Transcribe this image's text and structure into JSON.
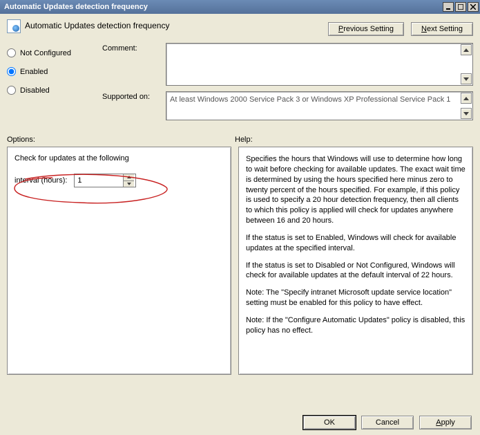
{
  "window": {
    "title": "Automatic Updates detection frequency"
  },
  "header": {
    "title": "Automatic Updates detection frequency",
    "prev_label": "Previous Setting",
    "next_label": "Next Setting"
  },
  "state": {
    "not_configured_label": "Not Configured",
    "enabled_label": "Enabled",
    "disabled_label": "Disabled",
    "selected": "enabled"
  },
  "meta": {
    "comment_label": "Comment:",
    "comment_value": "",
    "supported_label": "Supported on:",
    "supported_value": "At least Windows 2000 Service Pack 3 or Windows XP Professional Service Pack 1"
  },
  "sections": {
    "options_label": "Options:",
    "help_label": "Help:"
  },
  "options": {
    "heading": "Check for updates at the following",
    "interval_label": "interval (hours):",
    "interval_value": "1"
  },
  "help": {
    "p1": "Specifies the hours that Windows will use to determine how long to wait before checking for available updates. The exact wait time is determined by using the hours specified here minus zero to twenty percent of the hours specified. For example, if this policy is used to specify a 20 hour detection frequency, then all clients to which this policy is applied will check for updates anywhere between 16 and 20 hours.",
    "p2": "If the status is set to Enabled, Windows will check for available updates at the specified interval.",
    "p3": "If the status is set to Disabled or Not Configured, Windows will check for available updates at the default interval of 22 hours.",
    "p4": "Note: The \"Specify intranet Microsoft update service location\" setting must be enabled for this policy to have effect.",
    "p5": "Note: If the \"Configure Automatic Updates\" policy is disabled, this policy has no effect."
  },
  "buttons": {
    "ok": "OK",
    "cancel": "Cancel",
    "apply": "Apply"
  }
}
